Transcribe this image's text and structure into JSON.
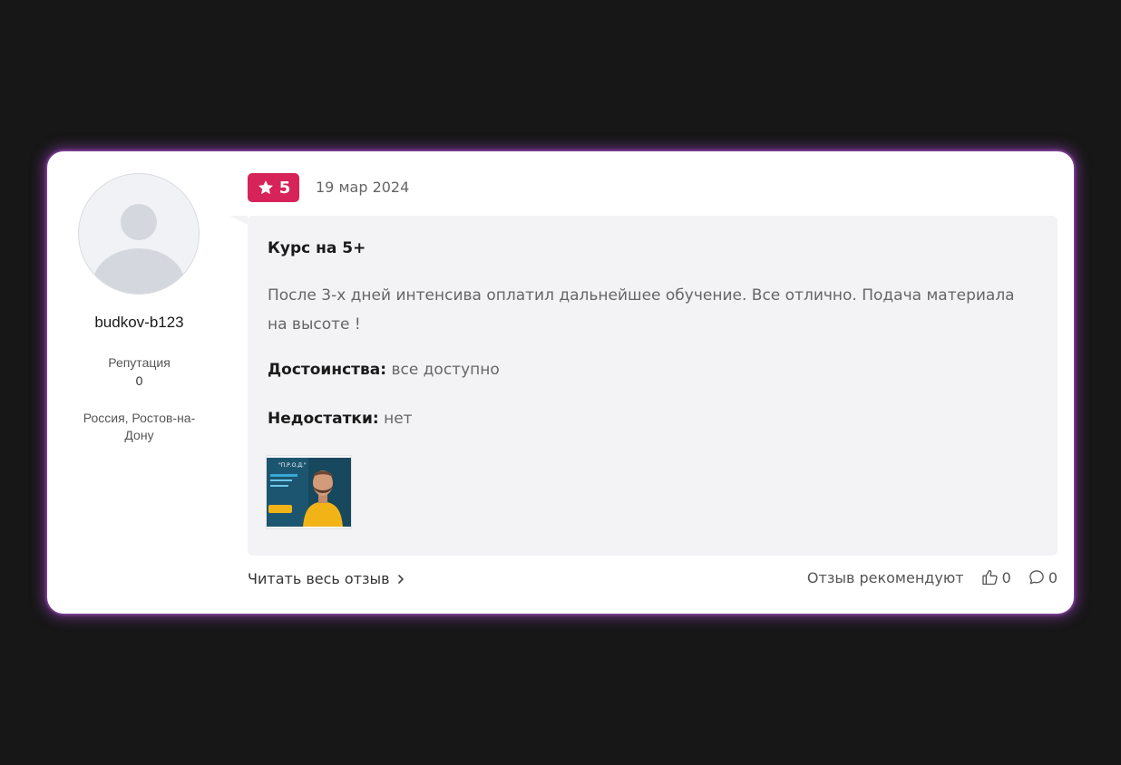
{
  "author": {
    "username": "budkov-b123",
    "reputation_label": "Репутация",
    "reputation_value": "0",
    "location": "Россия, Ростов-на-Дону"
  },
  "review": {
    "rating": "5",
    "date": "19 мар 2024",
    "title": "Курс на 5+",
    "text": "После 3-х дней интенсива оплатил дальнейшее обучение. Все отлично. Подача материала на высоте !",
    "pros_label": "Достоинства:",
    "pros_value": " все доступно",
    "cons_label": "Недостатки:",
    "cons_value": " нет",
    "image_badge_text": "\"П.Р.О.Д.\""
  },
  "footer": {
    "read_all_label": "Читать весь отзыв",
    "recommend_label": "Отзыв рекомендуют",
    "likes_count": "0",
    "comments_count": "0"
  },
  "colors": {
    "page_background": "#171717",
    "card_glow": "#aa46d2",
    "rating_badge": "#d6245a",
    "bubble_background": "#f3f3f5"
  },
  "icons": [
    "star-icon",
    "chevron-right-icon",
    "thumbs-up-icon",
    "comment-icon",
    "avatar-placeholder-icon"
  ]
}
